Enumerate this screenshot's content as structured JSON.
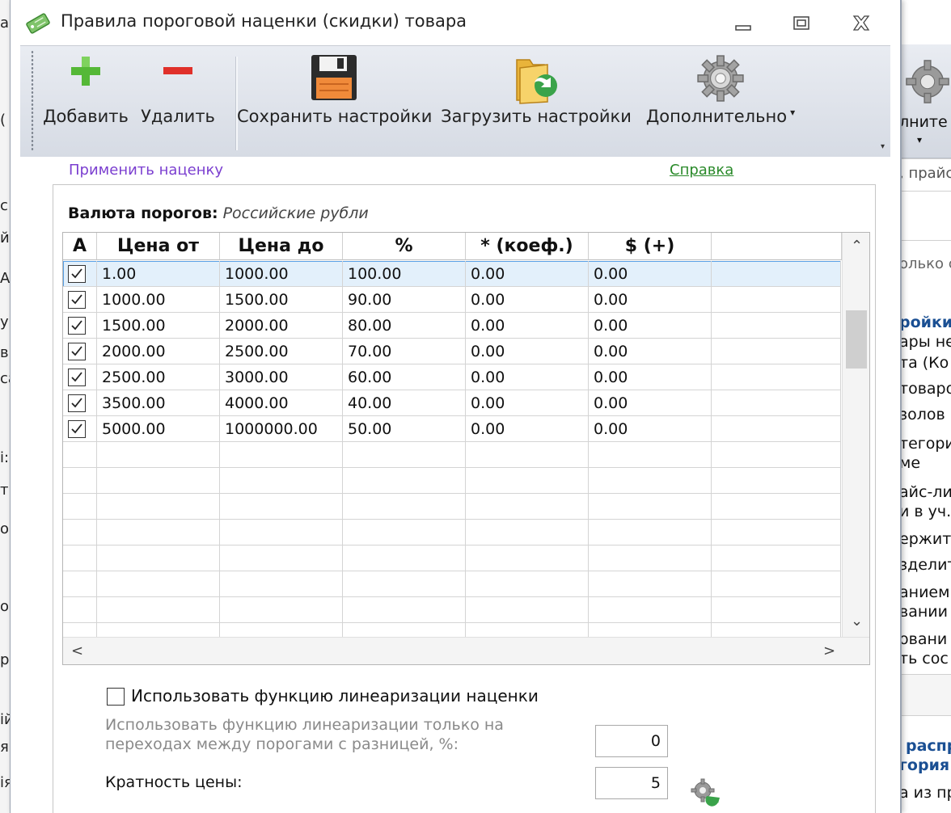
{
  "window": {
    "title": "Правила пороговой наценки (скидки) товара",
    "minimize_label": "Свернуть",
    "maximize_label": "Развернуть",
    "close_label": "Закрыть"
  },
  "toolbar": {
    "add": "Добавить",
    "delete": "Удалить",
    "save": "Сохранить настройки",
    "load": "Загрузить настройки",
    "more": "Дополнительно",
    "more_arrow": "▾",
    "overflow": "▾"
  },
  "links": {
    "apply": "Применить наценку",
    "help": "Справка"
  },
  "currency": {
    "label": "Валюта порогов:",
    "value": "Российские рубли"
  },
  "grid": {
    "headers": [
      "A",
      "Цена от",
      "Цена до",
      "%",
      "* (коеф.)",
      "$ (+)"
    ],
    "rows": [
      {
        "checked": true,
        "from": "1.00",
        "to": "1000.00",
        "pct": "100.00",
        "coef": "0.00",
        "plus": "0.00"
      },
      {
        "checked": true,
        "from": "1000.00",
        "to": "1500.00",
        "pct": "90.00",
        "coef": "0.00",
        "plus": "0.00"
      },
      {
        "checked": true,
        "from": "1500.00",
        "to": "2000.00",
        "pct": "80.00",
        "coef": "0.00",
        "plus": "0.00"
      },
      {
        "checked": true,
        "from": "2000.00",
        "to": "2500.00",
        "pct": "70.00",
        "coef": "0.00",
        "plus": "0.00"
      },
      {
        "checked": true,
        "from": "2500.00",
        "to": "3000.00",
        "pct": "60.00",
        "coef": "0.00",
        "plus": "0.00"
      },
      {
        "checked": true,
        "from": "3500.00",
        "to": "4000.00",
        "pct": "40.00",
        "coef": "0.00",
        "plus": "0.00"
      },
      {
        "checked": true,
        "from": "5000.00",
        "to": "1000000.00",
        "pct": "50.00",
        "coef": "0.00",
        "plus": "0.00"
      }
    ],
    "selected_row": 0,
    "scroll_up": "⌃",
    "scroll_down": "⌄",
    "scroll_left": "<",
    "scroll_right": ">"
  },
  "linearization": {
    "checkbox_label": "Использовать функцию линеаризации наценки",
    "checked": false,
    "description": "Использовать функцию линеаризации только на переходах между порогами с разницей, %:",
    "threshold_value": "0"
  },
  "multiplicity": {
    "label": "Кратность цены:",
    "value": "5"
  },
  "background_window": {
    "left_fragments": [
      "а",
      "(",
      "с:",
      "й",
      "А",
      "у",
      "в",
      "са",
      "і:",
      "тн",
      "о",
      "о",
      "р",
      "ій",
      "я",
      "ія"
    ],
    "right_fragments": [
      "лните",
      "▾",
      ", прайс",
      "олько с",
      "ройки",
      "ары не",
      "та (Ко",
      "товаро",
      "золов",
      "тегори",
      "ме",
      "айс-ли",
      "и в уч.",
      "ержит",
      "зделит",
      "анием",
      "вании",
      "овани",
      "ть сос",
      "распр",
      "гория",
      "а из пр"
    ]
  },
  "colors": {
    "accent_link": "#7b3fd0",
    "help_link": "#2a8a2a",
    "selected_row": "#e3f0fb",
    "selection_border": "#5aa0e4"
  }
}
